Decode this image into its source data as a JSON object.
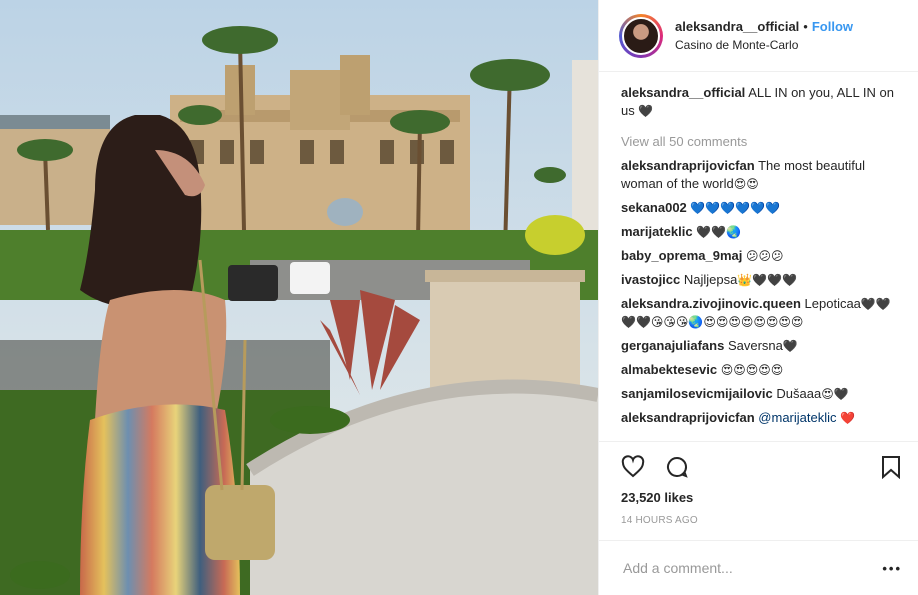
{
  "header": {
    "username": "aleksandra__official",
    "separator": "•",
    "follow_label": "Follow",
    "location": "Casino de Monte-Carlo"
  },
  "caption": {
    "username": "aleksandra__official",
    "text": "ALL IN on you, ALL IN on us",
    "emoji": "🖤"
  },
  "view_all": "View all 50 comments",
  "comments": [
    {
      "user": "aleksandraprijovicfan",
      "text": "The most beautiful woman of the world",
      "emoji": "😍😍"
    },
    {
      "user": "sekana002",
      "text": "",
      "emoji": "💙💙💙💙💙💙"
    },
    {
      "user": "marijateklic",
      "text": "",
      "emoji": "🖤🖤🌏"
    },
    {
      "user": "baby_oprema_9maj",
      "text": "",
      "emoji": "😕😕😕"
    },
    {
      "user": "ivastojicc",
      "text": "Najljepsa",
      "emoji": "👑🖤🖤🖤"
    },
    {
      "user": "aleksandra.zivojinovic.queen",
      "text": "Lepoticaa",
      "emoji": "🖤🖤🖤🖤😘😘😘🌏😍😍😍😍😍😍😍😍"
    },
    {
      "user": "gerganajuliafans",
      "text": "Saversna",
      "emoji": "🖤"
    },
    {
      "user": "almabektesevic",
      "text": "",
      "emoji": "😍😍😍😍😍"
    },
    {
      "user": "sanjamilosevicmijailovic",
      "text": "Dušaaa",
      "emoji": "😍🖤"
    },
    {
      "user": "aleksandraprijovicfan",
      "text": "",
      "mention": "@marijateklic",
      "emoji": "❤️"
    }
  ],
  "likes": "23,520 likes",
  "time": "14 HOURS AGO",
  "add_comment_placeholder": "Add a comment...",
  "more_label": "•••",
  "icons": {
    "like": "heart-icon",
    "comment": "comment-icon",
    "save": "bookmark-icon"
  }
}
